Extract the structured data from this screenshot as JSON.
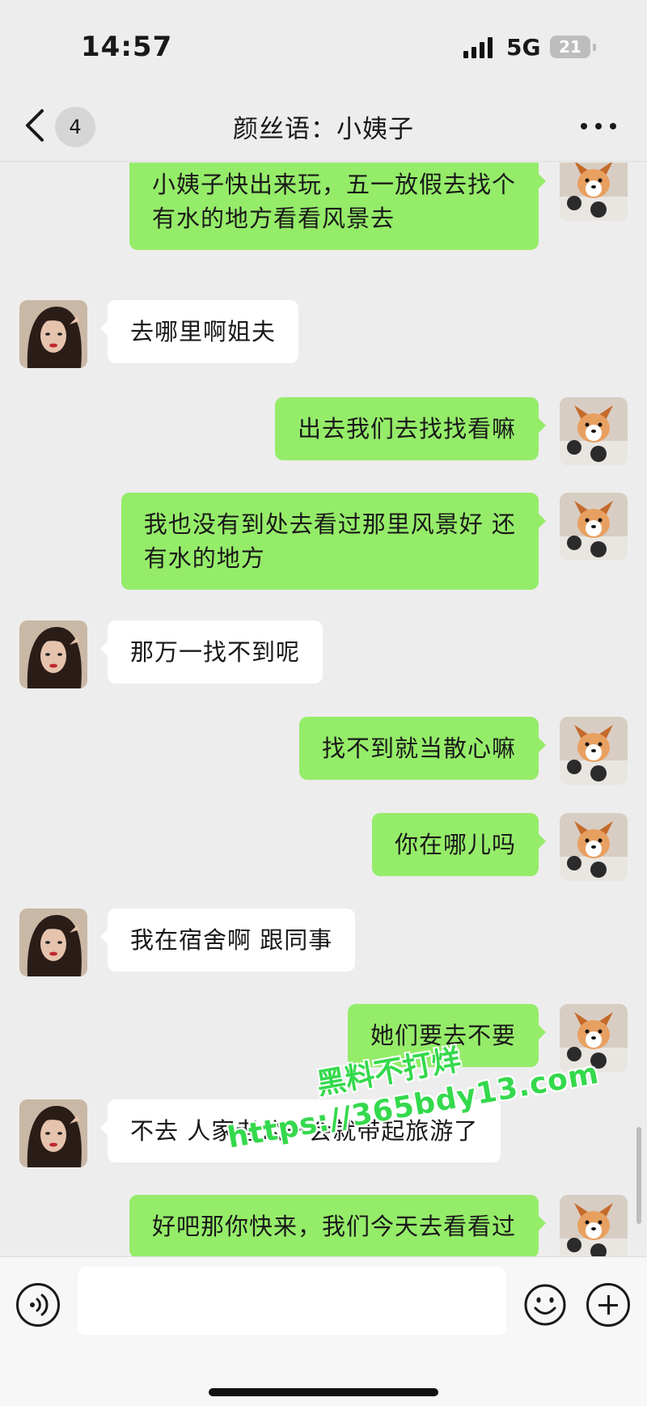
{
  "status_bar": {
    "time": "14:57",
    "network": "5G",
    "battery": "21"
  },
  "nav": {
    "unread_count": "4",
    "title": "颜丝语：小姨子"
  },
  "messages": [
    {
      "side": "out",
      "lines": [
        "小姨子快出来玩，五一放假去找个",
        "有水的地方看看风景去"
      ]
    },
    {
      "side": "in",
      "lines": [
        "去哪里啊姐夫"
      ]
    },
    {
      "side": "out",
      "lines": [
        "出去我们去找找看嘛"
      ]
    },
    {
      "side": "out",
      "lines": [
        "我也没有到处去看过那里风景好 还",
        "有水的地方"
      ]
    },
    {
      "side": "in",
      "lines": [
        "那万一找不到呢"
      ]
    },
    {
      "side": "out",
      "lines": [
        "找不到就当散心嘛"
      ]
    },
    {
      "side": "out",
      "lines": [
        "你在哪儿吗"
      ]
    },
    {
      "side": "in",
      "lines": [
        "我在宿舍啊 跟同事"
      ]
    },
    {
      "side": "out",
      "lines": [
        "她们要去不要"
      ]
    },
    {
      "side": "in",
      "lines": [
        "不去 人家老公一会就带起旅游了"
      ]
    },
    {
      "side": "out",
      "lines": [
        "好吧那你快来，我们今天去看看过"
      ]
    }
  ],
  "watermark": {
    "line1": "黑料不打烊",
    "line2": "https://365bdy13.com"
  },
  "colors": {
    "outgoing_bubble": "#95ec69",
    "incoming_bubble": "#ffffff",
    "background": "#ededed",
    "watermark": "#34d94c"
  },
  "icons": {
    "back": "chevron-left-icon",
    "more": "more-dots-icon",
    "voice": "voice-icon",
    "emoji": "emoji-icon",
    "plus": "plus-icon"
  }
}
